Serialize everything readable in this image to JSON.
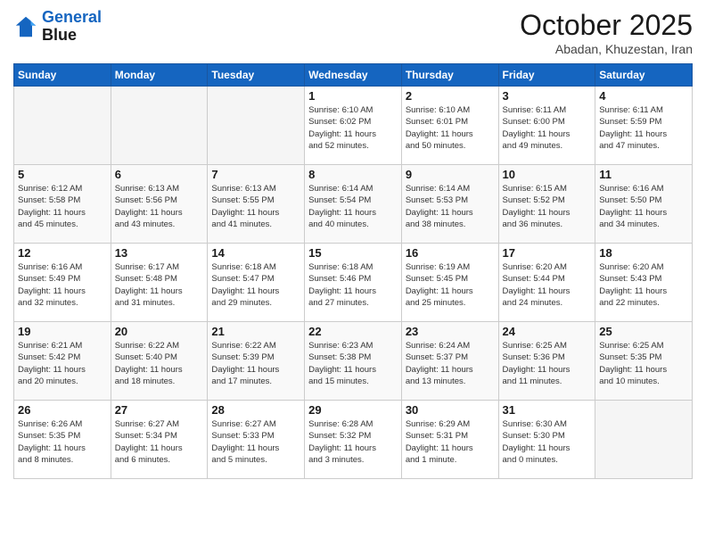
{
  "header": {
    "logo_line1": "General",
    "logo_line2": "Blue",
    "month": "October 2025",
    "location": "Abadan, Khuzestan, Iran"
  },
  "weekdays": [
    "Sunday",
    "Monday",
    "Tuesday",
    "Wednesday",
    "Thursday",
    "Friday",
    "Saturday"
  ],
  "weeks": [
    [
      {
        "day": "",
        "info": ""
      },
      {
        "day": "",
        "info": ""
      },
      {
        "day": "",
        "info": ""
      },
      {
        "day": "1",
        "info": "Sunrise: 6:10 AM\nSunset: 6:02 PM\nDaylight: 11 hours\nand 52 minutes."
      },
      {
        "day": "2",
        "info": "Sunrise: 6:10 AM\nSunset: 6:01 PM\nDaylight: 11 hours\nand 50 minutes."
      },
      {
        "day": "3",
        "info": "Sunrise: 6:11 AM\nSunset: 6:00 PM\nDaylight: 11 hours\nand 49 minutes."
      },
      {
        "day": "4",
        "info": "Sunrise: 6:11 AM\nSunset: 5:59 PM\nDaylight: 11 hours\nand 47 minutes."
      }
    ],
    [
      {
        "day": "5",
        "info": "Sunrise: 6:12 AM\nSunset: 5:58 PM\nDaylight: 11 hours\nand 45 minutes."
      },
      {
        "day": "6",
        "info": "Sunrise: 6:13 AM\nSunset: 5:56 PM\nDaylight: 11 hours\nand 43 minutes."
      },
      {
        "day": "7",
        "info": "Sunrise: 6:13 AM\nSunset: 5:55 PM\nDaylight: 11 hours\nand 41 minutes."
      },
      {
        "day": "8",
        "info": "Sunrise: 6:14 AM\nSunset: 5:54 PM\nDaylight: 11 hours\nand 40 minutes."
      },
      {
        "day": "9",
        "info": "Sunrise: 6:14 AM\nSunset: 5:53 PM\nDaylight: 11 hours\nand 38 minutes."
      },
      {
        "day": "10",
        "info": "Sunrise: 6:15 AM\nSunset: 5:52 PM\nDaylight: 11 hours\nand 36 minutes."
      },
      {
        "day": "11",
        "info": "Sunrise: 6:16 AM\nSunset: 5:50 PM\nDaylight: 11 hours\nand 34 minutes."
      }
    ],
    [
      {
        "day": "12",
        "info": "Sunrise: 6:16 AM\nSunset: 5:49 PM\nDaylight: 11 hours\nand 32 minutes."
      },
      {
        "day": "13",
        "info": "Sunrise: 6:17 AM\nSunset: 5:48 PM\nDaylight: 11 hours\nand 31 minutes."
      },
      {
        "day": "14",
        "info": "Sunrise: 6:18 AM\nSunset: 5:47 PM\nDaylight: 11 hours\nand 29 minutes."
      },
      {
        "day": "15",
        "info": "Sunrise: 6:18 AM\nSunset: 5:46 PM\nDaylight: 11 hours\nand 27 minutes."
      },
      {
        "day": "16",
        "info": "Sunrise: 6:19 AM\nSunset: 5:45 PM\nDaylight: 11 hours\nand 25 minutes."
      },
      {
        "day": "17",
        "info": "Sunrise: 6:20 AM\nSunset: 5:44 PM\nDaylight: 11 hours\nand 24 minutes."
      },
      {
        "day": "18",
        "info": "Sunrise: 6:20 AM\nSunset: 5:43 PM\nDaylight: 11 hours\nand 22 minutes."
      }
    ],
    [
      {
        "day": "19",
        "info": "Sunrise: 6:21 AM\nSunset: 5:42 PM\nDaylight: 11 hours\nand 20 minutes."
      },
      {
        "day": "20",
        "info": "Sunrise: 6:22 AM\nSunset: 5:40 PM\nDaylight: 11 hours\nand 18 minutes."
      },
      {
        "day": "21",
        "info": "Sunrise: 6:22 AM\nSunset: 5:39 PM\nDaylight: 11 hours\nand 17 minutes."
      },
      {
        "day": "22",
        "info": "Sunrise: 6:23 AM\nSunset: 5:38 PM\nDaylight: 11 hours\nand 15 minutes."
      },
      {
        "day": "23",
        "info": "Sunrise: 6:24 AM\nSunset: 5:37 PM\nDaylight: 11 hours\nand 13 minutes."
      },
      {
        "day": "24",
        "info": "Sunrise: 6:25 AM\nSunset: 5:36 PM\nDaylight: 11 hours\nand 11 minutes."
      },
      {
        "day": "25",
        "info": "Sunrise: 6:25 AM\nSunset: 5:35 PM\nDaylight: 11 hours\nand 10 minutes."
      }
    ],
    [
      {
        "day": "26",
        "info": "Sunrise: 6:26 AM\nSunset: 5:35 PM\nDaylight: 11 hours\nand 8 minutes."
      },
      {
        "day": "27",
        "info": "Sunrise: 6:27 AM\nSunset: 5:34 PM\nDaylight: 11 hours\nand 6 minutes."
      },
      {
        "day": "28",
        "info": "Sunrise: 6:27 AM\nSunset: 5:33 PM\nDaylight: 11 hours\nand 5 minutes."
      },
      {
        "day": "29",
        "info": "Sunrise: 6:28 AM\nSunset: 5:32 PM\nDaylight: 11 hours\nand 3 minutes."
      },
      {
        "day": "30",
        "info": "Sunrise: 6:29 AM\nSunset: 5:31 PM\nDaylight: 11 hours\nand 1 minute."
      },
      {
        "day": "31",
        "info": "Sunrise: 6:30 AM\nSunset: 5:30 PM\nDaylight: 11 hours\nand 0 minutes."
      },
      {
        "day": "",
        "info": ""
      }
    ]
  ]
}
